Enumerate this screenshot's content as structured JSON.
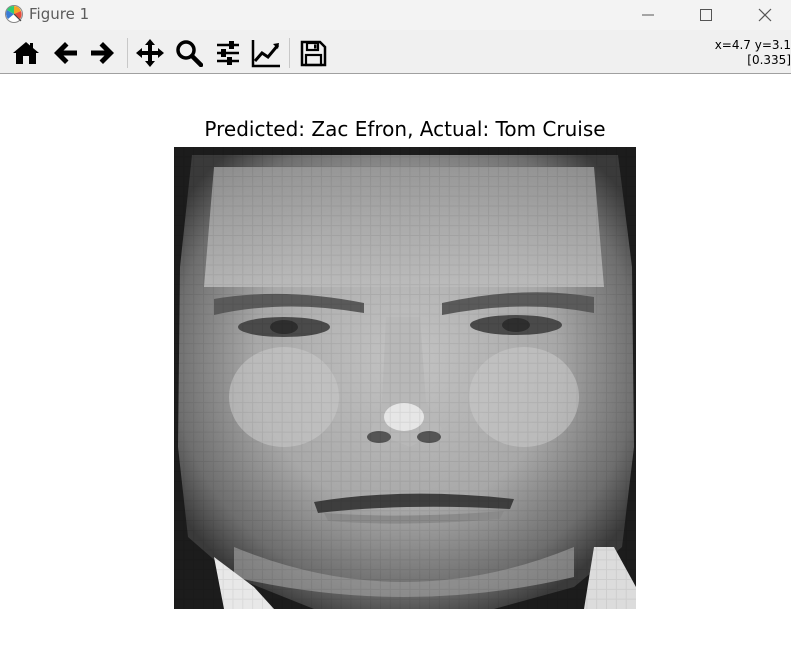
{
  "window": {
    "title": "Figure 1",
    "controls": [
      "minimize",
      "maximize",
      "close"
    ]
  },
  "toolbar": {
    "buttons": [
      {
        "name": "home",
        "icon": "home-icon"
      },
      {
        "name": "back",
        "icon": "arrow-left-icon"
      },
      {
        "name": "forward",
        "icon": "arrow-right-icon"
      },
      {
        "name": "pan",
        "icon": "move-icon"
      },
      {
        "name": "zoom",
        "icon": "magnifier-icon"
      },
      {
        "name": "subplots",
        "icon": "sliders-icon"
      },
      {
        "name": "edit-axis",
        "icon": "chart-line-icon"
      },
      {
        "name": "save",
        "icon": "floppy-icon"
      }
    ],
    "coord_readout_line1": "x=4.7 y=3.1",
    "coord_readout_line2": "[0.335]"
  },
  "figure": {
    "title": "Predicted: Zac Efron, Actual: Tom Cruise",
    "image": {
      "kind": "grayscale face photo",
      "colormap": "gray"
    }
  },
  "colors": {
    "titlebar_bg": "#f3f3f3",
    "toolbar_bg": "#f0f0f0",
    "icon_color": "#000000"
  }
}
